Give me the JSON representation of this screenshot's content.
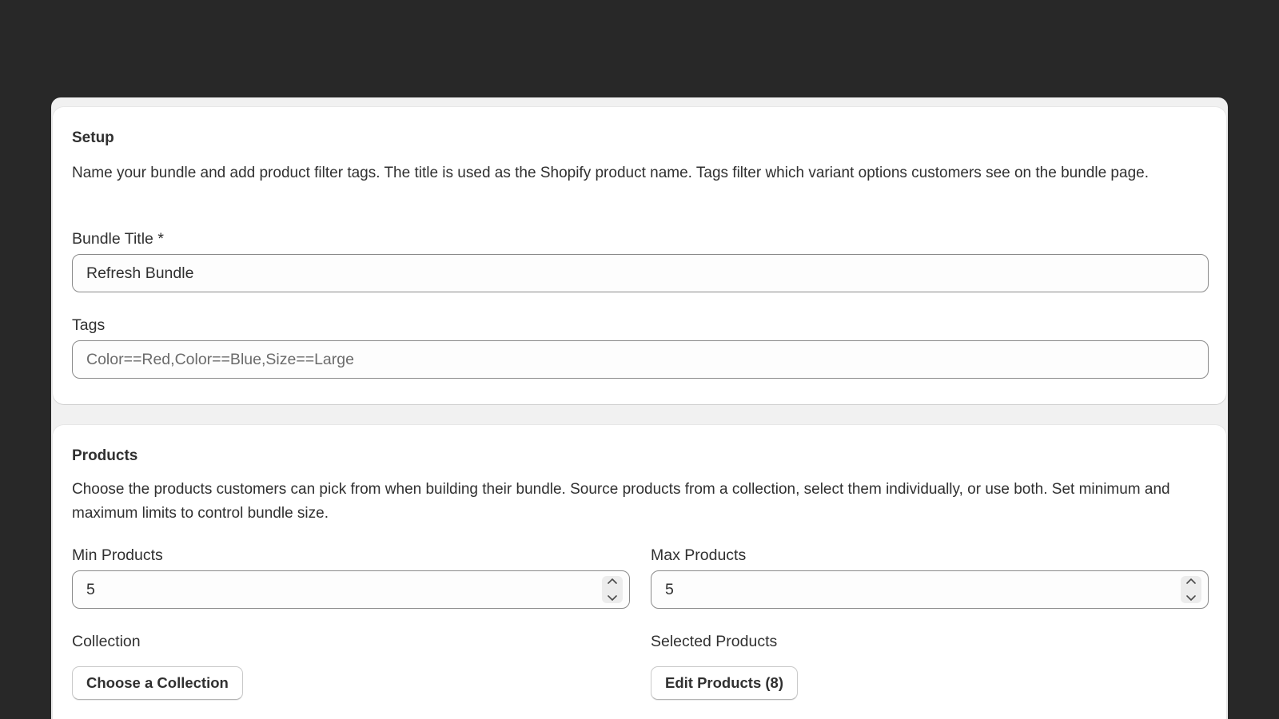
{
  "setup": {
    "heading": "Setup",
    "description": "Name your bundle and add product filter tags. The title is used as the Shopify product name. Tags filter which variant options customers see on the bundle page.",
    "bundle_title_label": "Bundle Title *",
    "bundle_title_value": "Refresh Bundle",
    "tags_label": "Tags",
    "tags_placeholder": "Color==Red,Color==Blue,Size==Large"
  },
  "products": {
    "heading": "Products",
    "description": "Choose the products customers can pick from when building their bundle. Source products from a collection, select them individually, or use both. Set minimum and maximum limits to control bundle size.",
    "min_label": "Min Products",
    "min_value": "5",
    "max_label": "Max Products",
    "max_value": "5",
    "collection_label": "Collection",
    "collection_button": "Choose a Collection",
    "selected_label": "Selected Products",
    "edit_button": "Edit Products (8)"
  },
  "colors": {
    "backdrop": "#282828",
    "frame": "#f1f1f1",
    "card": "#ffffff",
    "text": "#303030",
    "input_border": "#8a8a8a"
  },
  "icons": {
    "stepper_up": "chevron-up-icon",
    "stepper_down": "chevron-down-icon"
  }
}
